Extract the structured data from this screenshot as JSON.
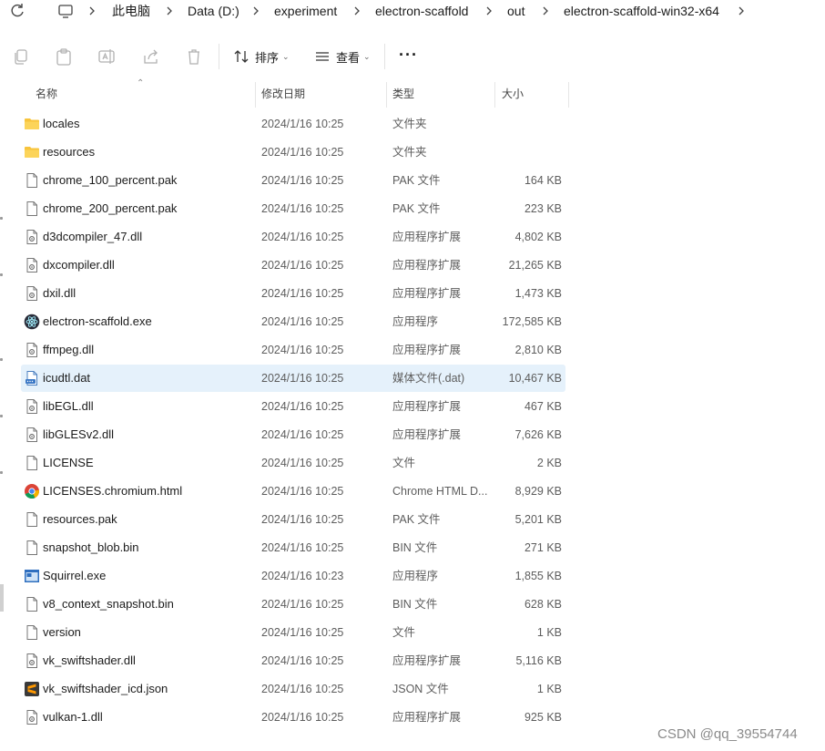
{
  "breadcrumb": {
    "items": [
      "此电脑",
      "Data (D:)",
      "experiment",
      "electron-scaffold",
      "out",
      "electron-scaffold-win32-x64"
    ]
  },
  "toolbar": {
    "sort_label": "排序",
    "view_label": "查看",
    "more_label": "···"
  },
  "columns": {
    "name": "名称",
    "date": "修改日期",
    "type": "类型",
    "size": "大小"
  },
  "files": [
    {
      "name": "locales",
      "date": "2024/1/16 10:25",
      "type": "文件夹",
      "size": "",
      "icon": "folder-icon"
    },
    {
      "name": "resources",
      "date": "2024/1/16 10:25",
      "type": "文件夹",
      "size": "",
      "icon": "folder-icon"
    },
    {
      "name": "chrome_100_percent.pak",
      "date": "2024/1/16 10:25",
      "type": "PAK 文件",
      "size": "164 KB",
      "icon": "file-icon"
    },
    {
      "name": "chrome_200_percent.pak",
      "date": "2024/1/16 10:25",
      "type": "PAK 文件",
      "size": "223 KB",
      "icon": "file-icon"
    },
    {
      "name": "d3dcompiler_47.dll",
      "date": "2024/1/16 10:25",
      "type": "应用程序扩展",
      "size": "4,802 KB",
      "icon": "dll-icon"
    },
    {
      "name": "dxcompiler.dll",
      "date": "2024/1/16 10:25",
      "type": "应用程序扩展",
      "size": "21,265 KB",
      "icon": "dll-icon"
    },
    {
      "name": "dxil.dll",
      "date": "2024/1/16 10:25",
      "type": "应用程序扩展",
      "size": "1,473 KB",
      "icon": "dll-icon"
    },
    {
      "name": "electron-scaffold.exe",
      "date": "2024/1/16 10:25",
      "type": "应用程序",
      "size": "172,585 KB",
      "icon": "electron-icon"
    },
    {
      "name": "ffmpeg.dll",
      "date": "2024/1/16 10:25",
      "type": "应用程序扩展",
      "size": "2,810 KB",
      "icon": "dll-icon"
    },
    {
      "name": "icudtl.dat",
      "date": "2024/1/16 10:25",
      "type": "媒体文件(.dat)",
      "size": "10,467 KB",
      "icon": "media-file-icon",
      "selected": true
    },
    {
      "name": "libEGL.dll",
      "date": "2024/1/16 10:25",
      "type": "应用程序扩展",
      "size": "467 KB",
      "icon": "dll-icon"
    },
    {
      "name": "libGLESv2.dll",
      "date": "2024/1/16 10:25",
      "type": "应用程序扩展",
      "size": "7,626 KB",
      "icon": "dll-icon"
    },
    {
      "name": "LICENSE",
      "date": "2024/1/16 10:25",
      "type": "文件",
      "size": "2 KB",
      "icon": "file-icon"
    },
    {
      "name": "LICENSES.chromium.html",
      "date": "2024/1/16 10:25",
      "type": "Chrome HTML D...",
      "size": "8,929 KB",
      "icon": "chrome-icon"
    },
    {
      "name": "resources.pak",
      "date": "2024/1/16 10:25",
      "type": "PAK 文件",
      "size": "5,201 KB",
      "icon": "file-icon"
    },
    {
      "name": "snapshot_blob.bin",
      "date": "2024/1/16 10:25",
      "type": "BIN 文件",
      "size": "271 KB",
      "icon": "file-icon"
    },
    {
      "name": "Squirrel.exe",
      "date": "2024/1/16 10:23",
      "type": "应用程序",
      "size": "1,855 KB",
      "icon": "exe-window-icon"
    },
    {
      "name": "v8_context_snapshot.bin",
      "date": "2024/1/16 10:25",
      "type": "BIN 文件",
      "size": "628 KB",
      "icon": "file-icon"
    },
    {
      "name": "version",
      "date": "2024/1/16 10:25",
      "type": "文件",
      "size": "1 KB",
      "icon": "file-icon"
    },
    {
      "name": "vk_swiftshader.dll",
      "date": "2024/1/16 10:25",
      "type": "应用程序扩展",
      "size": "5,116 KB",
      "icon": "dll-icon"
    },
    {
      "name": "vk_swiftshader_icd.json",
      "date": "2024/1/16 10:25",
      "type": "JSON 文件",
      "size": "1 KB",
      "icon": "sublime-icon"
    },
    {
      "name": "vulkan-1.dll",
      "date": "2024/1/16 10:25",
      "type": "应用程序扩展",
      "size": "925 KB",
      "icon": "dll-icon"
    }
  ],
  "watermark": "CSDN @qq_39554744",
  "colors": {
    "folder": "#f8c43c",
    "selected_row": "#e5f1fb",
    "muted_text": "#5d5d5d"
  }
}
